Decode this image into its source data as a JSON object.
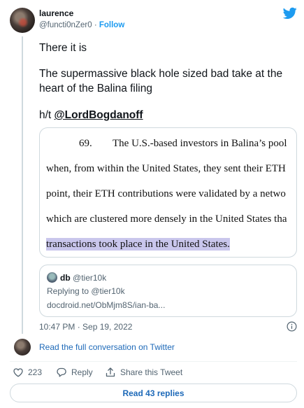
{
  "author": {
    "name": "laurence",
    "handle": "@functi0nZer0",
    "separator": "·",
    "follow_label": "Follow"
  },
  "tweet": {
    "line1": "There it is",
    "line2": "The supermassive black hole sized bad take at the heart of the Balina filing",
    "hat_tip_prefix": "h/t",
    "mention": "@LordBogdanoff"
  },
  "document": {
    "paragraph_number": "69.",
    "line1": "The U.S.-based investors in Balina’s pool",
    "line2": "when, from within the United States, they sent their ETH",
    "line3": "point, their ETH contributions were validated by a netwo",
    "line4": "which are clustered more densely in the United States tha",
    "line5_highlighted": "transactions took place in the United States."
  },
  "quoted_tweet": {
    "name": "db",
    "handle": "@tier10k",
    "replying_to": "Replying to @tier10k",
    "link": "docdroid.net/ObMjm8S/ian-ba..."
  },
  "timestamp": "10:47 PM · Sep 19, 2022",
  "read_conversation": "Read the full conversation on Twitter",
  "actions": {
    "like_count": "223",
    "reply_label": "Reply",
    "share_label": "Share this Tweet"
  },
  "read_replies_label": "Read 43 replies",
  "colors": {
    "accent": "#1d9bf0",
    "link": "#1d69b8",
    "muted": "#536471",
    "highlight": "#c9c6ec"
  },
  "icons": [
    "twitter-bird-icon",
    "info-icon",
    "heart-icon",
    "reply-icon",
    "share-icon"
  ]
}
